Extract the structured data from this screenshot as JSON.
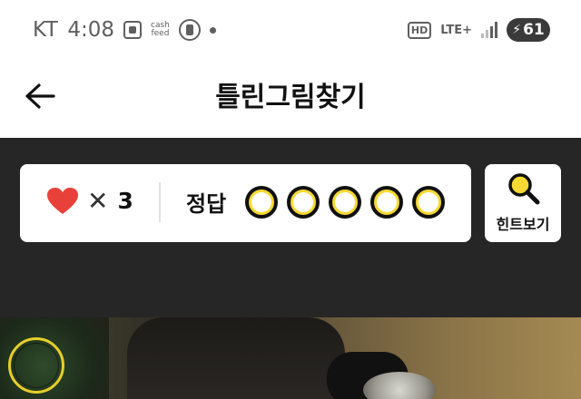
{
  "status_bar": {
    "carrier": "KT",
    "time": "4:08",
    "cashfeed_line1": "cash",
    "cashfeed_line2": "feed",
    "hd": "HD",
    "lte": "LTE+",
    "battery": "61",
    "icon_color": "#5f5f5f"
  },
  "header": {
    "title": "틀린그림찾기",
    "back_icon": "arrow-left-icon"
  },
  "game": {
    "lives_icon": "heart-icon",
    "lives_separator": "✕",
    "lives_count": "3",
    "answer_label": "정답",
    "answers_total": 5,
    "answers_found": 0,
    "hint_label": "힌트보기",
    "hint_icon": "magnifier-icon",
    "accent_color": "#f6d933",
    "heart_color": "#e8413a"
  },
  "photo": {
    "marked_spots": 1
  }
}
